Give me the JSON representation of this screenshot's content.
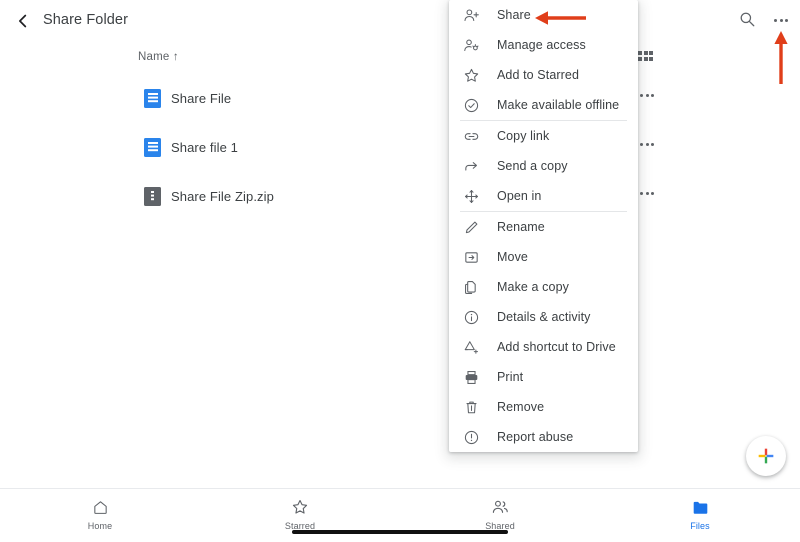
{
  "appbar": {
    "title": "Share Folder",
    "back_icon": "chevron-left-icon",
    "search_icon": "search-icon",
    "overflow_icon": "more-vert-icon"
  },
  "list": {
    "sort_header": "Name ↑",
    "view_toggle_icon": "grid-view-icon",
    "rows": [
      {
        "name": "Share File",
        "icon": "google-docs-icon",
        "type": "doc",
        "overflow_icon": "more-vert-icon"
      },
      {
        "name": "Share file 1",
        "icon": "google-docs-icon",
        "type": "doc",
        "overflow_icon": "more-vert-icon"
      },
      {
        "name": "Share File Zip.zip",
        "icon": "zip-file-icon",
        "type": "zip",
        "overflow_icon": "more-vert-icon"
      }
    ]
  },
  "menu": {
    "items": [
      {
        "label": "Share",
        "icon": "person-add-icon",
        "divider_after": false
      },
      {
        "label": "Manage access",
        "icon": "manage-accounts-icon",
        "divider_after": false
      },
      {
        "label": "Add to Starred",
        "icon": "star-outline-icon",
        "divider_after": false
      },
      {
        "label": "Make available offline",
        "icon": "offline-pin-icon",
        "divider_after": true
      },
      {
        "label": "Copy link",
        "icon": "link-icon",
        "divider_after": false
      },
      {
        "label": "Send a copy",
        "icon": "send-arrow-icon",
        "divider_after": false
      },
      {
        "label": "Open in",
        "icon": "open-in-move-icon",
        "divider_after": true
      },
      {
        "label": "Rename",
        "icon": "pencil-icon",
        "divider_after": false
      },
      {
        "label": "Move",
        "icon": "move-to-folder-icon",
        "divider_after": false
      },
      {
        "label": "Make a copy",
        "icon": "copy-icon",
        "divider_after": false
      },
      {
        "label": "Details & activity",
        "icon": "info-circle-icon",
        "divider_after": false
      },
      {
        "label": "Add shortcut to Drive",
        "icon": "add-to-drive-icon",
        "divider_after": false
      },
      {
        "label": "Print",
        "icon": "printer-icon",
        "divider_after": false
      },
      {
        "label": "Remove",
        "icon": "trash-icon",
        "divider_after": false
      },
      {
        "label": "Report abuse",
        "icon": "report-warning-icon",
        "divider_after": false
      }
    ]
  },
  "annotations": {
    "color": "#E03E1A",
    "arrow_to_share": "arrow-pointing-left-at-share",
    "arrow_to_overflow": "arrow-pointing-up-at-overflow-menu"
  },
  "fab": {
    "icon": "google-plus-icon",
    "label": "Create"
  },
  "bottom_nav": {
    "active": "Files",
    "items": [
      {
        "label": "Home",
        "icon": "home-icon",
        "active": false
      },
      {
        "label": "Starred",
        "icon": "star-outline-icon",
        "active": false
      },
      {
        "label": "Shared",
        "icon": "people-icon",
        "active": false
      },
      {
        "label": "Files",
        "icon": "folder-icon",
        "active": true
      }
    ]
  },
  "colors": {
    "accent_blue": "#1a73e8",
    "doc_blue": "#2a84eb",
    "zip_gray": "#5f6368",
    "annotation_red": "#E03E1A",
    "text_primary": "#3c4043",
    "text_secondary": "#5f6368"
  }
}
